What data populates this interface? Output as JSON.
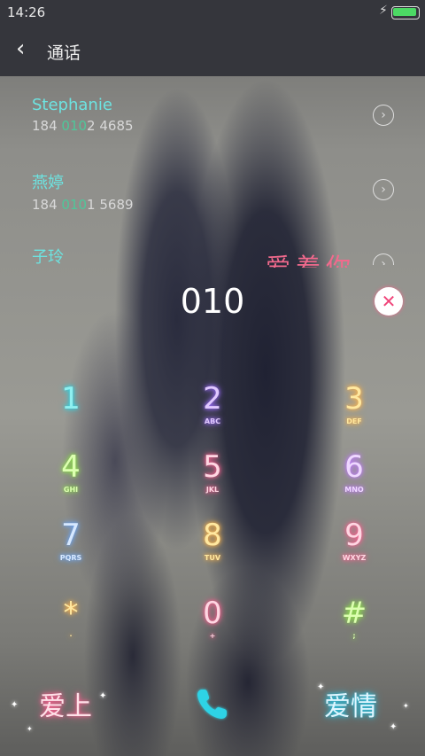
{
  "status_bar": {
    "time": "14:26"
  },
  "header": {
    "title": "通话"
  },
  "contacts": [
    {
      "name": "Stephanie",
      "number_pre": "184 ",
      "number_hl": "010",
      "number_post": "2 4685"
    },
    {
      "name": "燕婷",
      "number_pre": "184 ",
      "number_hl": "010",
      "number_post": "1 5689"
    },
    {
      "name": "子玲"
    }
  ],
  "decorative_text": "爱着你",
  "dialed_number": "010",
  "keypad": [
    {
      "digit": "1",
      "letters": ""
    },
    {
      "digit": "2",
      "letters": "ABC"
    },
    {
      "digit": "3",
      "letters": "DEF"
    },
    {
      "digit": "4",
      "letters": "GHI"
    },
    {
      "digit": "5",
      "letters": "JKL"
    },
    {
      "digit": "6",
      "letters": "MNO"
    },
    {
      "digit": "7",
      "letters": "PQRS"
    },
    {
      "digit": "8",
      "letters": "TUV"
    },
    {
      "digit": "9",
      "letters": "WXYZ"
    },
    {
      "digit": "*",
      "letters": "·"
    },
    {
      "digit": "0",
      "letters": "+"
    },
    {
      "digit": "#",
      "letters": ";"
    }
  ],
  "bottom": {
    "left_label": "爱上",
    "right_label": "爱情"
  },
  "icons": {
    "back": "back-arrow-icon",
    "clear": "clear-icon",
    "call": "phone-icon",
    "contact_detail": "chevron-right-icon",
    "battery": "battery-icon",
    "charging": "charging-icon"
  },
  "colors": {
    "accent_contact": "#6de3e0",
    "match_highlight": "#4ec79a",
    "clear_button": "#f0457a",
    "call_button": "#2fd3e6"
  }
}
